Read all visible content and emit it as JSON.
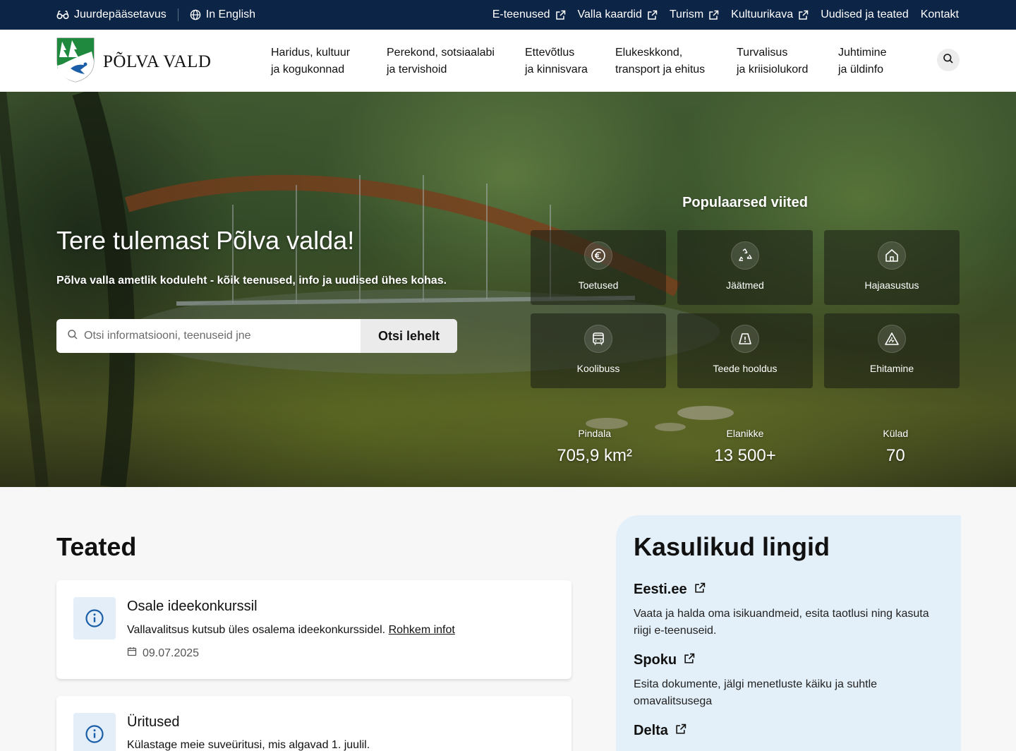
{
  "topbar": {
    "accessibility": "Juurdepääsetavus",
    "language": "In English",
    "links": [
      {
        "label": "E-teenused",
        "external": true
      },
      {
        "label": "Valla kaardid",
        "external": true
      },
      {
        "label": "Turism",
        "external": true
      },
      {
        "label": "Kultuurikava",
        "external": true
      },
      {
        "label": "Uudised ja teated",
        "external": false
      },
      {
        "label": "Kontakt",
        "external": false
      }
    ]
  },
  "header": {
    "logo_text": "PÕLVA VALD",
    "nav": [
      {
        "line1": "Haridus, kultuur",
        "line2": "ja kogukonnad"
      },
      {
        "line1": "Perekond, sotsiaalabi",
        "line2": "ja tervishoid"
      },
      {
        "line1": "Ettevõtlus",
        "line2": "ja kinnisvara"
      },
      {
        "line1": "Elukeskkond,",
        "line2": "transport ja ehitus"
      },
      {
        "line1": "Turvalisus",
        "line2": "ja kriisiolukord"
      },
      {
        "line1": "Juhtimine",
        "line2": "ja üldinfo"
      }
    ]
  },
  "hero": {
    "title": "Tere tulemast Põlva valda!",
    "subtitle": "Põlva valla ametlik koduleht - kõik teenused, info ja uudised ühes kohas.",
    "search_placeholder": "Otsi informatsiooni, teenuseid jne",
    "search_button": "Otsi lehelt",
    "popular_title": "Populaarsed viited",
    "popular": [
      {
        "label": "Toetused",
        "icon": "euro-icon"
      },
      {
        "label": "Jäätmed",
        "icon": "recycle-icon"
      },
      {
        "label": "Hajaasustus",
        "icon": "house-icon"
      },
      {
        "label": "Koolibuss",
        "icon": "bus-icon"
      },
      {
        "label": "Teede hooldus",
        "icon": "road-warning-icon"
      },
      {
        "label": "Ehitamine",
        "icon": "construction-icon"
      }
    ],
    "stats": [
      {
        "label": "Pindala",
        "value": "705,9 km²"
      },
      {
        "label": "Elanikke",
        "value": "13 500+"
      },
      {
        "label": "Külad",
        "value": "70"
      }
    ]
  },
  "teated": {
    "title": "Teated",
    "items": [
      {
        "title": "Osale ideekonkurssil",
        "text": "Vallavalitsus kutsub üles osalema ideekonkurssidel.",
        "link": "Rohkem infot",
        "date": "09.07.2025"
      },
      {
        "title": "Üritused",
        "text": "Külastage meie suveüritusi, mis algavad 1. juulil.",
        "link": "",
        "date": ""
      }
    ]
  },
  "useful_links": {
    "title": "Kasulikud lingid",
    "items": [
      {
        "title": "Eesti.ee",
        "desc": "Vaata ja halda oma isikuandmeid, esita taotlusi ning kasuta riigi e-teenuseid."
      },
      {
        "title": "Spoku",
        "desc": "Esita dokumente, jälgi menetluste käiku ja suhtle omavalitsusega"
      },
      {
        "title": "Delta",
        "desc": ""
      }
    ]
  },
  "colors": {
    "topbar_bg": "#0c2445",
    "accent_blue": "#1a5ea8",
    "side_panel_bg": "#e4f0f9",
    "card_icon_bg": "#e3eef8"
  }
}
